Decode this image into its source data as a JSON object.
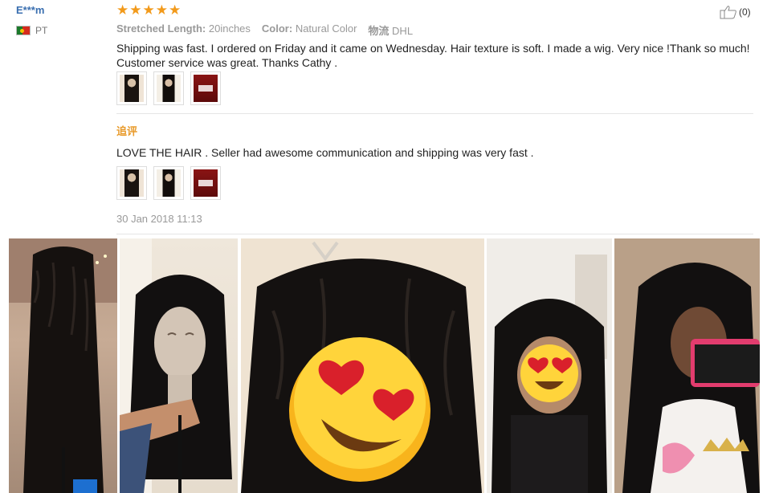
{
  "reviewer": {
    "name": "E***m",
    "country": "PT"
  },
  "rating": {
    "stars": 5,
    "star_glyph": "★"
  },
  "like": {
    "count_label": "(0)",
    "icon": "thumbs-up-icon"
  },
  "meta": {
    "stretched_length_label": "Stretched Length:",
    "stretched_length_value": "20inches",
    "color_label": "Color:",
    "color_value": "Natural Color",
    "shipping_label": "物流",
    "shipping_value": "DHL"
  },
  "review": {
    "text": "Shipping was fast. I ordered on Friday and it came on Wednesday. Hair texture is soft. I made a wig. Very nice !Thank so much! Customer service was great. Thanks Cathy ."
  },
  "followup": {
    "label": "追评",
    "text": "LOVE THE HAIR . Seller had awesome communication and shipping was very fast ."
  },
  "date": "30 Jan 2018 11:13",
  "colors": {
    "accent_orange": "#f29a1b",
    "name_blue": "#3a6fb0",
    "heart_red": "#d9202b"
  }
}
